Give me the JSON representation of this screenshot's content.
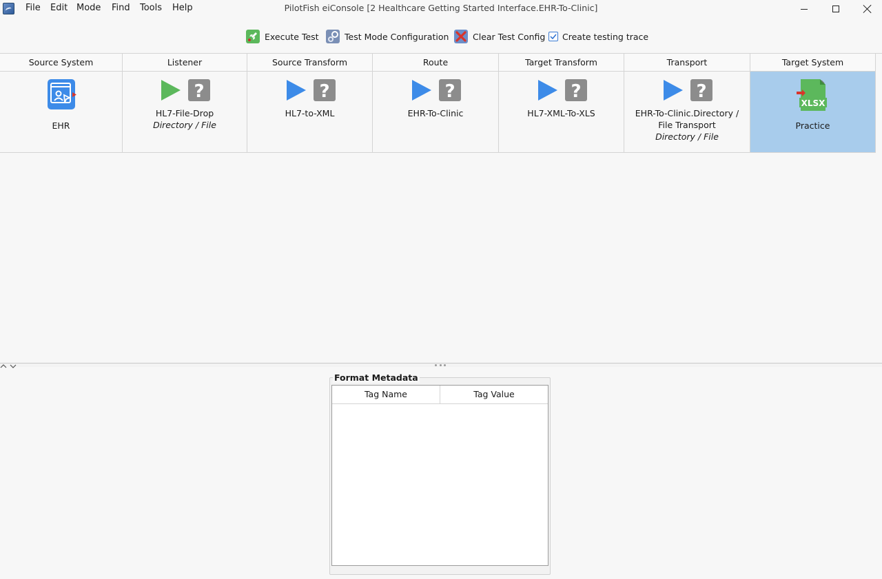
{
  "menu": {
    "items": [
      "File",
      "Edit",
      "Mode",
      "Find",
      "Tools",
      "Help"
    ]
  },
  "window": {
    "title": "PilotFish eiConsole [2 Healthcare Getting Started Interface.EHR-To-Clinic]"
  },
  "toolbar": {
    "execute_test": "Execute Test",
    "test_mode_config": "Test Mode Configuration",
    "clear_test_config": "Clear Test Config",
    "create_trace": "Create testing trace",
    "create_trace_checked": true
  },
  "stages": [
    {
      "header": "Source System",
      "label": "EHR",
      "sublabel": ""
    },
    {
      "header": "Listener",
      "label": "HL7-File-Drop",
      "sublabel": "Directory / File"
    },
    {
      "header": "Source Transform",
      "label": "HL7-to-XML",
      "sublabel": ""
    },
    {
      "header": "Route",
      "label": "EHR-To-Clinic",
      "sublabel": ""
    },
    {
      "header": "Target Transform",
      "label": "HL7-XML-To-XLS",
      "sublabel": ""
    },
    {
      "header": "Transport",
      "label": "EHR-To-Clinic.Directory /",
      "label2": "File Transport",
      "sublabel": "Directory / File"
    },
    {
      "header": "Target System",
      "label": "Practice",
      "sublabel": "",
      "icon_text": "XLSX"
    }
  ],
  "metadata": {
    "title": "Format Metadata",
    "columns": [
      "Tag Name",
      "Tag Value"
    ]
  },
  "colors": {
    "selected_stage": "#a8ccec",
    "play_green": "#5cb85c",
    "play_blue": "#3d8be8",
    "question_gray": "#8c8c8c"
  }
}
